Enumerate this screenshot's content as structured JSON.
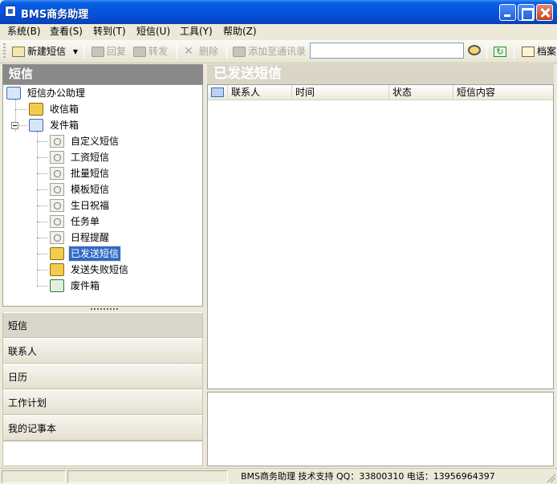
{
  "window": {
    "title": "BMS商务助理"
  },
  "menu": [
    {
      "label": "系统(B)"
    },
    {
      "label": "查看(S)"
    },
    {
      "label": "转到(T)"
    },
    {
      "label": "短信(U)"
    },
    {
      "label": "工具(Y)"
    },
    {
      "label": "帮助(Z)"
    }
  ],
  "toolbar": {
    "new_sms": "新建短信",
    "reply": "回复",
    "forward": "转发",
    "delete": "删除",
    "add_contact": "添加至通讯录",
    "search_value": "",
    "archive": "档案"
  },
  "left": {
    "header": "短信",
    "tree": {
      "root": "短信办公助理",
      "inbox": "收信箱",
      "outbox": "发件箱",
      "children": [
        "自定义短信",
        "工资短信",
        "批量短信",
        "模板短信",
        "生日祝福",
        "任务单",
        "日程提醒"
      ],
      "sent": "已发送短信",
      "failed": "发送失败短信",
      "trash": "废件箱"
    },
    "nav": [
      "短信",
      "联系人",
      "日历",
      "工作计划",
      "我的记事本"
    ]
  },
  "right": {
    "header": "已发送短信",
    "columns": [
      "联系人",
      "时间",
      "状态",
      "短信内容"
    ]
  },
  "status": {
    "text": "BMS商务助理  技术支持  QQ：33800310  电话：13956964397"
  }
}
